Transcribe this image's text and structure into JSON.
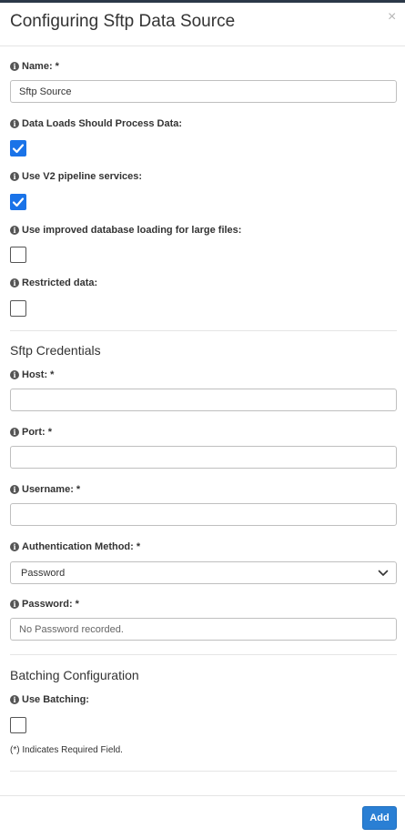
{
  "modal": {
    "title": "Configuring Sftp Data Source",
    "close_glyph": "×"
  },
  "fields": {
    "name": {
      "label": "Name: *",
      "value": "Sftp Source"
    },
    "process_data": {
      "label": "Data Loads Should Process Data:",
      "checked": true
    },
    "v2_pipeline": {
      "label": "Use V2 pipeline services:",
      "checked": true
    },
    "improved_loading": {
      "label": "Use improved database loading for large files:",
      "checked": false
    },
    "restricted": {
      "label": "Restricted data:",
      "checked": false
    }
  },
  "credentials": {
    "title": "Sftp Credentials",
    "host": {
      "label": "Host: *",
      "value": ""
    },
    "port": {
      "label": "Port: *",
      "value": ""
    },
    "username": {
      "label": "Username: *",
      "value": ""
    },
    "auth_method": {
      "label": "Authentication Method: *",
      "selected": "Password"
    },
    "password": {
      "label": "Password: *",
      "placeholder": "No Password recorded."
    }
  },
  "batching": {
    "title": "Batching Configuration",
    "use_batching": {
      "label": "Use Batching:",
      "checked": false
    }
  },
  "note": "(*) Indicates Required Field.",
  "footer": {
    "add_label": "Add"
  },
  "colors": {
    "accent": "#1a73e8",
    "button": "#2a7fd4"
  }
}
